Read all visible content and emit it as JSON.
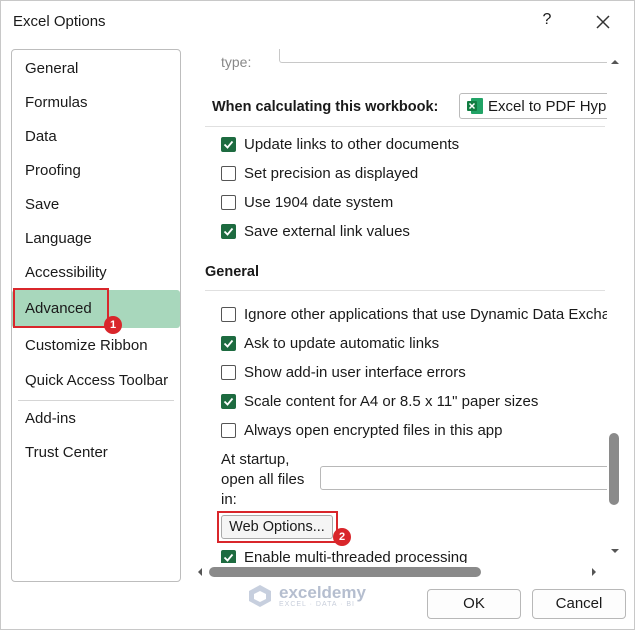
{
  "window": {
    "title": "Excel Options",
    "help": "?",
    "close": "✕"
  },
  "nav": {
    "items": [
      {
        "label": "General"
      },
      {
        "label": "Formulas"
      },
      {
        "label": "Data"
      },
      {
        "label": "Proofing"
      },
      {
        "label": "Save"
      },
      {
        "label": "Language"
      },
      {
        "label": "Accessibility"
      },
      {
        "label": "Advanced",
        "selected": true
      },
      {
        "label": "Customize Ribbon"
      },
      {
        "label": "Quick Access Toolbar"
      },
      {
        "label": "Add-ins"
      },
      {
        "label": "Trust Center"
      }
    ]
  },
  "annotations": {
    "step1": "1",
    "step2": "2",
    "color": "#d9262b"
  },
  "content": {
    "type_label": "type:",
    "calc_heading": "When calculating this workbook:",
    "workbook_select": "Excel to PDF Hype",
    "calc_options": [
      {
        "label": "Update links to other documents",
        "checked": true
      },
      {
        "label": "Set precision as displayed",
        "checked": false
      },
      {
        "label": "Use 1904 date system",
        "checked": false
      },
      {
        "label": "Save external link values",
        "checked": true
      }
    ],
    "general_heading": "General",
    "general_options": [
      {
        "label": "Ignore other applications that use Dynamic Data Excha",
        "checked": false
      },
      {
        "label": "Ask to update automatic links",
        "checked": true
      },
      {
        "label": "Show add-in user interface errors",
        "checked": false
      },
      {
        "label": "Scale content for A4 or 8.5 x 11\" paper sizes",
        "checked": true
      },
      {
        "label": "Always open encrypted files in this app",
        "checked": false
      }
    ],
    "startup_label_1": "At startup,",
    "startup_label_2": "open all files",
    "startup_label_3": "in:",
    "startup_value": "",
    "web_options_button": "Web Options...",
    "multithread_label": "Enable multi-threaded processing",
    "multithread_checked": true
  },
  "footer": {
    "ok": "OK",
    "cancel": "Cancel"
  },
  "watermark": {
    "name": "exceldemy",
    "tagline": "EXCEL · DATA · BI"
  },
  "colors": {
    "accent": "#1d6b40",
    "selected_nav": "#a8d7bc"
  }
}
